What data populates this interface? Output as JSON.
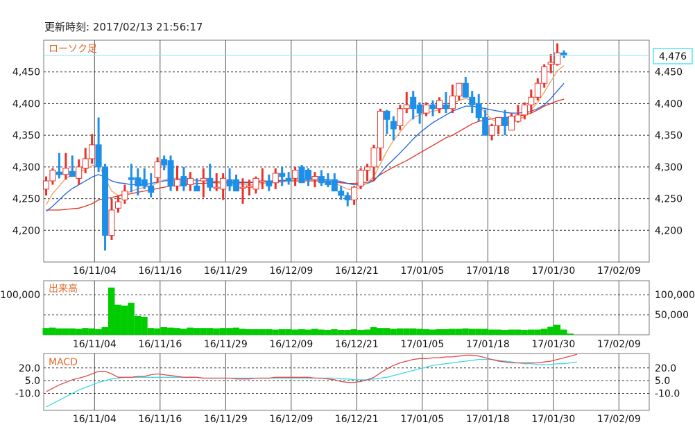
{
  "header": {
    "timestamp": "更新時刻: 2017/02/13 21:56:17"
  },
  "panels": {
    "price": {
      "title": "ローソク足",
      "ylim": [
        4150,
        4500
      ],
      "ticks": [
        4200,
        4250,
        4300,
        4350,
        4400,
        4450
      ],
      "tick_labels": [
        "4,200",
        "4,250",
        "4,300",
        "4,350",
        "4,400",
        "4,450"
      ]
    },
    "volume": {
      "title": "出来高",
      "ylim": [
        0,
        135000
      ],
      "ticks": [
        50000,
        100000
      ],
      "tick_labels_left": [
        "",
        "100,000"
      ],
      "tick_labels_right": [
        "50,000",
        "100,000"
      ]
    },
    "macd": {
      "title": "MACD",
      "ylim": [
        -30,
        37
      ],
      "ticks": [
        20,
        5,
        -10
      ],
      "tick_labels": [
        "20.0",
        "5.0",
        "-10.0"
      ]
    }
  },
  "current_price": {
    "value": 4476,
    "label": "4,476"
  },
  "colors": {
    "up": "#e8332b",
    "down": "#1e8fe8",
    "volume": "#00cc00",
    "ma_short": "#f0a060",
    "ma_mid": "#2060e0",
    "ma_long": "#e03020",
    "macd": "#e04a4a",
    "signal": "#40d8e0",
    "current": "#80e8f8",
    "title": "#e06a2c"
  },
  "chart_data": [
    {
      "type": "candlestick",
      "title": "ローソク足",
      "x_tick_labels": [
        "16/11/04",
        "16/11/16",
        "16/11/29",
        "16/12/09",
        "16/12/21",
        "17/01/05",
        "17/01/18",
        "17/01/30",
        "17/02/09"
      ],
      "x_tick_index": [
        4,
        14,
        24,
        34,
        44,
        54,
        64,
        74,
        84
      ],
      "ylim": [
        4150,
        4500
      ],
      "ohlc": [
        [
          4265,
          4285,
          4255,
          4278
        ],
        [
          4278,
          4298,
          4272,
          4295
        ],
        [
          4292,
          4322,
          4282,
          4288
        ],
        [
          4288,
          4322,
          4280,
          4298
        ],
        [
          4293,
          4318,
          4285,
          4285
        ],
        [
          4282,
          4312,
          4272,
          4300
        ],
        [
          4298,
          4330,
          4290,
          4313
        ],
        [
          4313,
          4352,
          4305,
          4335
        ],
        [
          4335,
          4378,
          4292,
          4300
        ],
        [
          4300,
          4305,
          4168,
          4192
        ],
        [
          4192,
          4250,
          4185,
          4232
        ],
        [
          4235,
          4255,
          4228,
          4245
        ],
        [
          4248,
          4272,
          4242,
          4262
        ],
        [
          4283,
          4305,
          4260,
          4280
        ],
        [
          4283,
          4298,
          4255,
          4270
        ],
        [
          4280,
          4298,
          4265,
          4270
        ],
        [
          4270,
          4290,
          4252,
          4260
        ],
        [
          4283,
          4315,
          4275,
          4308
        ],
        [
          4312,
          4318,
          4295,
          4303
        ],
        [
          4310,
          4318,
          4262,
          4270
        ],
        [
          4270,
          4302,
          4262,
          4280
        ],
        [
          4285,
          4300,
          4262,
          4270
        ],
        [
          4272,
          4292,
          4262,
          4282
        ],
        [
          4270,
          4282,
          4262,
          4262
        ],
        [
          4278,
          4298,
          4252,
          4282
        ],
        [
          4282,
          4305,
          4262,
          4268
        ],
        [
          4268,
          4290,
          4262,
          4268
        ],
        [
          4265,
          4290,
          4248,
          4282
        ],
        [
          4280,
          4298,
          4262,
          4270
        ],
        [
          4280,
          4288,
          4262,
          4262
        ],
        [
          4268,
          4282,
          4242,
          4268
        ],
        [
          4268,
          4280,
          4255,
          4270
        ],
        [
          4265,
          4285,
          4258,
          4282
        ],
        [
          4278,
          4298,
          4265,
          4278
        ],
        [
          4278,
          4288,
          4262,
          4270
        ],
        [
          4275,
          4298,
          4265,
          4290
        ],
        [
          4290,
          4300,
          4270,
          4285
        ],
        [
          4282,
          4292,
          4272,
          4278
        ],
        [
          4282,
          4300,
          4270,
          4295
        ],
        [
          4300,
          4303,
          4275,
          4275
        ],
        [
          4295,
          4298,
          4270,
          4280
        ],
        [
          4280,
          4292,
          4268,
          4285
        ],
        [
          4285,
          4295,
          4270,
          4275
        ],
        [
          4278,
          4290,
          4268,
          4272
        ],
        [
          4280,
          4290,
          4262,
          4262
        ],
        [
          4262,
          4270,
          4248,
          4255
        ],
        [
          4255,
          4260,
          4238,
          4248
        ],
        [
          4248,
          4270,
          4240,
          4268
        ],
        [
          4270,
          4298,
          4265,
          4295
        ],
        [
          4295,
          4305,
          4278,
          4300
        ],
        [
          4300,
          4335,
          4278,
          4330
        ],
        [
          4330,
          4392,
          4310,
          4388
        ],
        [
          4388,
          4390,
          4352,
          4375
        ],
        [
          4372,
          4380,
          4342,
          4360
        ],
        [
          4365,
          4398,
          4358,
          4392
        ],
        [
          4392,
          4418,
          4385,
          4398
        ],
        [
          4410,
          4420,
          4375,
          4392
        ],
        [
          4398,
          4402,
          4368,
          4385
        ],
        [
          4385,
          4402,
          4380,
          4398
        ],
        [
          4398,
          4405,
          4380,
          4392
        ],
        [
          4392,
          4410,
          4385,
          4405
        ],
        [
          4398,
          4418,
          4385,
          4392
        ],
        [
          4392,
          4430,
          4385,
          4412
        ],
        [
          4412,
          4432,
          4405,
          4432
        ],
        [
          4432,
          4442,
          4410,
          4410
        ],
        [
          4410,
          4420,
          4385,
          4398
        ],
        [
          4400,
          4415,
          4372,
          4378
        ],
        [
          4378,
          4390,
          4350,
          4350
        ],
        [
          4350,
          4368,
          4342,
          4365
        ],
        [
          4365,
          4378,
          4352,
          4378
        ],
        [
          4378,
          4390,
          4350,
          4365
        ],
        [
          4358,
          4385,
          4365,
          4380
        ],
        [
          4372,
          4398,
          4370,
          4382
        ],
        [
          4382,
          4402,
          4375,
          4398
        ],
        [
          4398,
          4422,
          4385,
          4410
        ],
        [
          4410,
          4440,
          4405,
          4432
        ],
        [
          4432,
          4462,
          4425,
          4458
        ],
        [
          4462,
          4478,
          4448,
          4465
        ],
        [
          4462,
          4495,
          4460,
          4480
        ],
        [
          4480,
          4484,
          4472,
          4476
        ]
      ],
      "ma_short": [
        4240,
        4258,
        4270,
        4282,
        4288,
        4292,
        4296,
        4302,
        4305,
        4282,
        4262,
        4255,
        4258,
        4262,
        4265,
        4268,
        4270,
        4275,
        4280,
        4282,
        4282,
        4280,
        4280,
        4278,
        4278,
        4278,
        4276,
        4275,
        4275,
        4274,
        4272,
        4272,
        4272,
        4274,
        4274,
        4276,
        4276,
        4278,
        4280,
        4280,
        4282,
        4282,
        4280,
        4278,
        4275,
        4270,
        4265,
        4264,
        4268,
        4275,
        4285,
        4305,
        4325,
        4342,
        4355,
        4368,
        4378,
        4382,
        4385,
        4388,
        4390,
        4395,
        4400,
        4405,
        4408,
        4405,
        4398,
        4385,
        4375,
        4370,
        4368,
        4370,
        4374,
        4380,
        4390,
        4402,
        4418,
        4435,
        4452,
        4460
      ],
      "ma_mid": [
        4230,
        4238,
        4248,
        4258,
        4266,
        4272,
        4278,
        4284,
        4288,
        4284,
        4278,
        4275,
        4274,
        4272,
        4272,
        4272,
        4274,
        4276,
        4278,
        4279,
        4280,
        4280,
        4280,
        4279,
        4278,
        4278,
        4277,
        4276,
        4276,
        4276,
        4276,
        4276,
        4276,
        4277,
        4278,
        4278,
        4279,
        4279,
        4280,
        4280,
        4280,
        4281,
        4281,
        4280,
        4279,
        4277,
        4274,
        4272,
        4272,
        4274,
        4278,
        4290,
        4302,
        4312,
        4322,
        4333,
        4344,
        4354,
        4362,
        4370,
        4376,
        4382,
        4388,
        4392,
        4396,
        4396,
        4394,
        4392,
        4390,
        4388,
        4386,
        4385,
        4385,
        4386,
        4388,
        4392,
        4398,
        4408,
        4420,
        4432
      ],
      "ma_long": [
        4232,
        4232,
        4232,
        4233,
        4234,
        4235,
        4238,
        4242,
        4248,
        4250,
        4252,
        4254,
        4256,
        4258,
        4260,
        4262,
        4264,
        4266,
        4268,
        4270,
        4271,
        4272,
        4273,
        4274,
        4274,
        4275,
        4275,
        4275,
        4275,
        4275,
        4275,
        4275,
        4276,
        4276,
        4277,
        4277,
        4278,
        4278,
        4278,
        4278,
        4278,
        4278,
        4278,
        4277,
        4276,
        4275,
        4274,
        4274,
        4275,
        4276,
        4280,
        4288,
        4294,
        4300,
        4305,
        4310,
        4316,
        4322,
        4328,
        4334,
        4340,
        4346,
        4350,
        4356,
        4362,
        4368,
        4372,
        4374,
        4376,
        4377,
        4378,
        4379,
        4380,
        4382,
        4385,
        4390,
        4396,
        4400,
        4404,
        4407
      ],
      "current_price": 4476
    },
    {
      "type": "bar",
      "title": "出来高",
      "ylim": [
        0,
        135000
      ],
      "values": [
        17000,
        18000,
        16000,
        16000,
        16000,
        15000,
        17000,
        16000,
        14000,
        19000,
        118000,
        75000,
        73000,
        80000,
        47000,
        45000,
        17000,
        16000,
        19000,
        18000,
        17000,
        15000,
        18000,
        17000,
        17000,
        17000,
        16000,
        17000,
        17000,
        18000,
        15000,
        14000,
        14000,
        14000,
        14000,
        13000,
        14000,
        14000,
        13000,
        14000,
        13000,
        15000,
        13000,
        12000,
        14000,
        12000,
        12000,
        14000,
        12000,
        13000,
        19000,
        17000,
        17000,
        15000,
        16000,
        16000,
        16000,
        15000,
        14000,
        13000,
        14000,
        14000,
        15000,
        15000,
        16000,
        15000,
        15000,
        15000,
        13000,
        13000,
        12000,
        13000,
        13000,
        12000,
        13000,
        13000,
        15000,
        20000,
        25000,
        13000,
        3000
      ]
    },
    {
      "type": "line",
      "title": "MACD",
      "ylim": [
        -30,
        37
      ],
      "series": [
        {
          "values": [
            -8,
            -4,
            0,
            3,
            6,
            8,
            10,
            13,
            16,
            16,
            13,
            9,
            9,
            9,
            10,
            10,
            12,
            13,
            12,
            11,
            10,
            9,
            9,
            9,
            8,
            8,
            8,
            8,
            8,
            7,
            7,
            7,
            8,
            8,
            8,
            9,
            9,
            9,
            9,
            9,
            9,
            8,
            8,
            7,
            6,
            4,
            3,
            3,
            4,
            6,
            9,
            14,
            19,
            23,
            26,
            28,
            30,
            31,
            31,
            32,
            32,
            33,
            33,
            34,
            35,
            35,
            34,
            32,
            30,
            28,
            27,
            26,
            26,
            26,
            26,
            26,
            27,
            28,
            30,
            32,
            34,
            36
          ]
        },
        {
          "values": [
            -26,
            -22,
            -18,
            -14,
            -10,
            -6,
            -3,
            0,
            3,
            5,
            7,
            8,
            9,
            9,
            9,
            9,
            9,
            9,
            9,
            9,
            9,
            9,
            9,
            9,
            8,
            8,
            8,
            8,
            8,
            8,
            8,
            8,
            8,
            8,
            8,
            8,
            8,
            8,
            8,
            8,
            8,
            8,
            8,
            8,
            8,
            7,
            7,
            6,
            6,
            6,
            7,
            8,
            9,
            11,
            13,
            15,
            17,
            19,
            21,
            23,
            24,
            25,
            26,
            27,
            28,
            29,
            30,
            30,
            30,
            29,
            28,
            27,
            26,
            25,
            25,
            24,
            24,
            24,
            25,
            25,
            26,
            27
          ]
        }
      ]
    }
  ]
}
